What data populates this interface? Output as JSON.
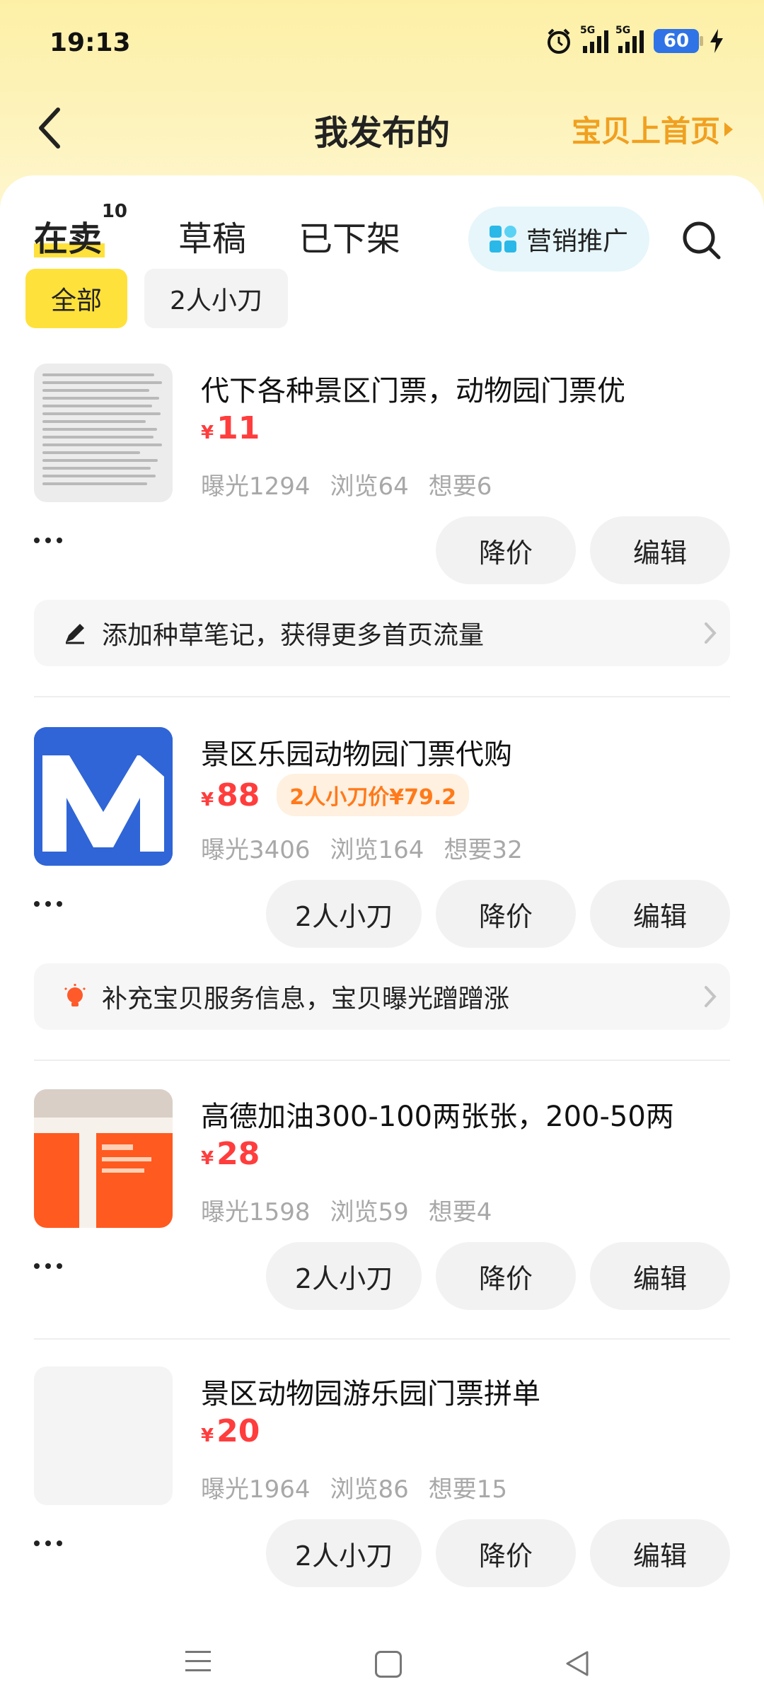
{
  "status": {
    "time": "19:13",
    "battery": "60",
    "net1": "5G",
    "net2": "5G"
  },
  "nav": {
    "title": "我发布的",
    "right_link": "宝贝上首页"
  },
  "tabs": [
    {
      "label": "在卖",
      "count": "10"
    },
    {
      "label": "草稿"
    },
    {
      "label": "已下架"
    }
  ],
  "promo": {
    "label": "营销推广"
  },
  "filters": [
    {
      "label": "全部"
    },
    {
      "label": "2人小刀"
    }
  ],
  "items": [
    {
      "title": "代下各种景区门票，动物园门票优",
      "price": "11",
      "currency": "¥",
      "stats": {
        "exposure": "曝光1294",
        "views": "浏览64",
        "wants": "想要6"
      },
      "buttons": {
        "reduce": "降价",
        "edit": "编辑"
      },
      "tip": "添加种草笔记，获得更多首页流量"
    },
    {
      "title": "景区乐园动物园门票代购",
      "price": "88",
      "currency": "¥",
      "bargain_tag": "2人小刀价¥79.2",
      "stats": {
        "exposure": "曝光3406",
        "views": "浏览164",
        "wants": "想要32"
      },
      "buttons": {
        "bargain": "2人小刀",
        "reduce": "降价",
        "edit": "编辑"
      },
      "tip": "补充宝贝服务信息，宝贝曝光蹭蹭涨"
    },
    {
      "title": "高德加油300-100两张张，200-50两",
      "price": "28",
      "currency": "¥",
      "stats": {
        "exposure": "曝光1598",
        "views": "浏览59",
        "wants": "想要4"
      },
      "buttons": {
        "bargain": "2人小刀",
        "reduce": "降价",
        "edit": "编辑"
      }
    },
    {
      "title": "景区动物园游乐园门票拼单",
      "price": "20",
      "currency": "¥",
      "stats": {
        "exposure": "曝光1964",
        "views": "浏览86",
        "wants": "想要15"
      },
      "buttons": {
        "bargain": "2人小刀",
        "reduce": "降价",
        "edit": "编辑"
      }
    }
  ],
  "colors": {
    "accent_yellow": "#ffe13b",
    "price_red": "#ff3d3d",
    "link_orange": "#f0a020"
  }
}
